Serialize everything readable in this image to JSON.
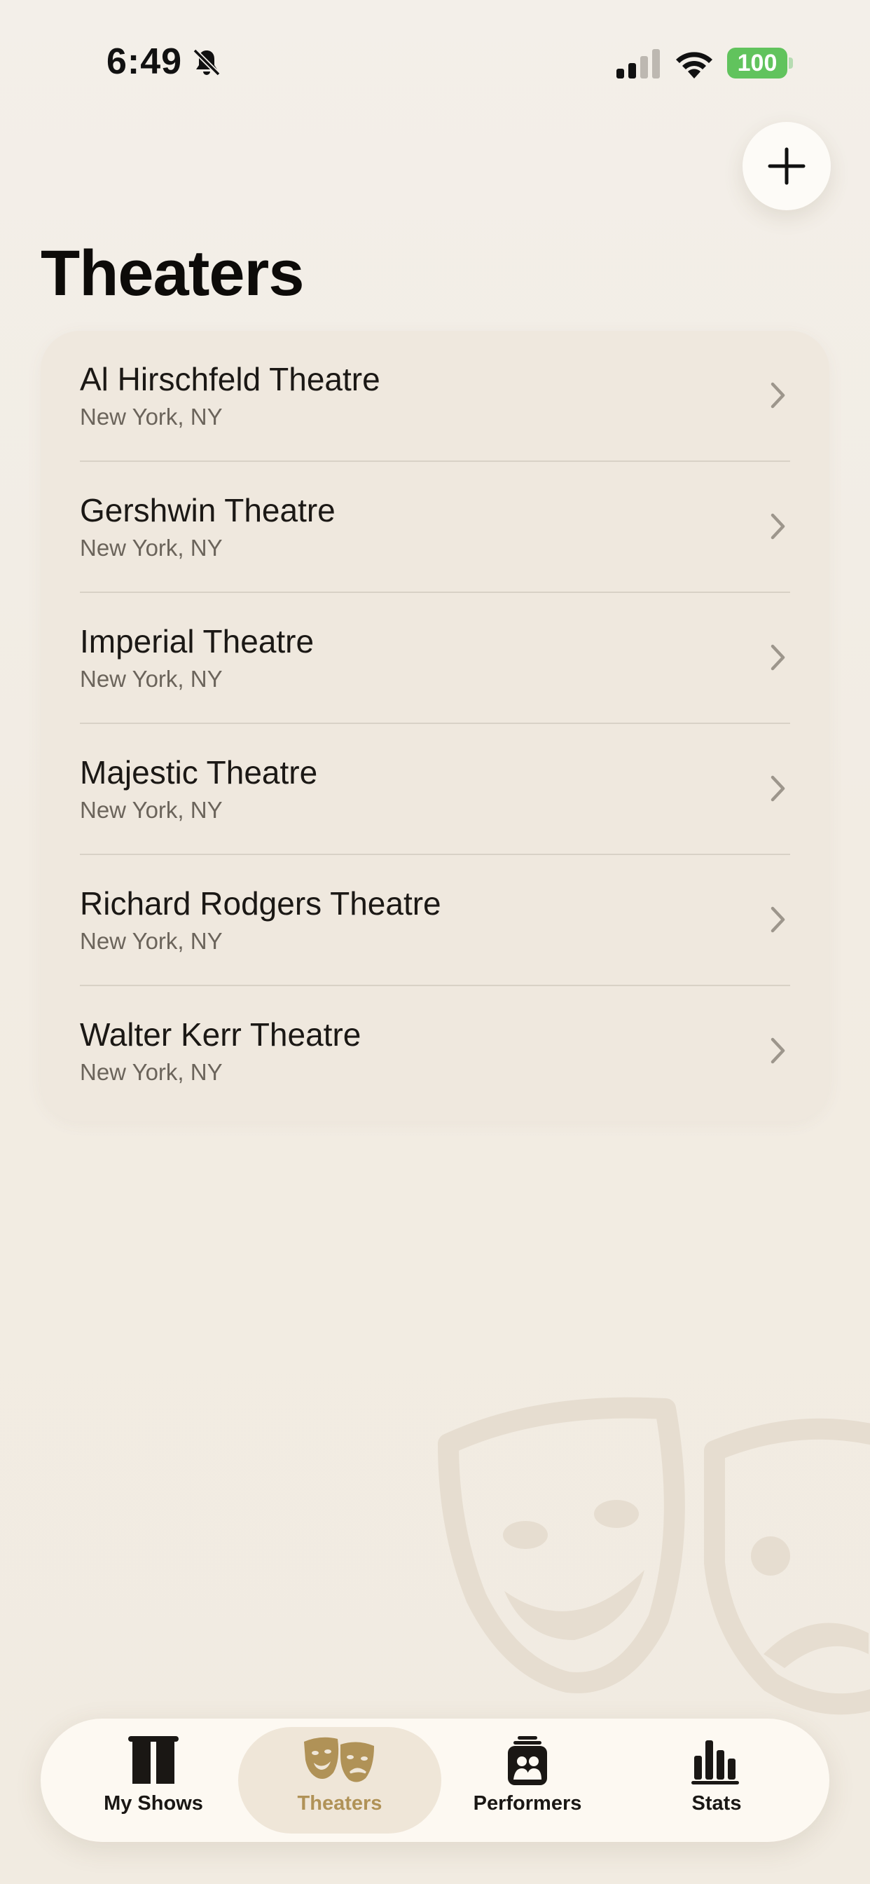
{
  "status_bar": {
    "time": "6:49",
    "battery": "100",
    "icons": [
      "bell-slash-icon",
      "cellular-signal-icon",
      "wifi-icon",
      "battery-icon"
    ]
  },
  "header": {
    "title": "Theaters",
    "add_icon": "plus-icon"
  },
  "theaters": [
    {
      "name": "Al Hirschfeld Theatre",
      "location": "New York, NY"
    },
    {
      "name": "Gershwin Theatre",
      "location": "New York, NY"
    },
    {
      "name": "Imperial Theatre",
      "location": "New York, NY"
    },
    {
      "name": "Majestic Theatre",
      "location": "New York, NY"
    },
    {
      "name": "Richard Rodgers Theatre",
      "location": "New York, NY"
    },
    {
      "name": "Walter Kerr Theatre",
      "location": "New York, NY"
    }
  ],
  "tab_bar": {
    "tabs": [
      {
        "label": "My Shows",
        "icon": "curtain-icon",
        "active": false
      },
      {
        "label": "Theaters",
        "icon": "theater-masks-icon",
        "active": true
      },
      {
        "label": "Performers",
        "icon": "performers-icon",
        "active": false
      },
      {
        "label": "Stats",
        "icon": "bar-chart-icon",
        "active": false
      }
    ]
  },
  "colors": {
    "background": "#f2ede5",
    "card": "#efe8de",
    "accent": "#b09257",
    "battery": "#61c35d"
  }
}
